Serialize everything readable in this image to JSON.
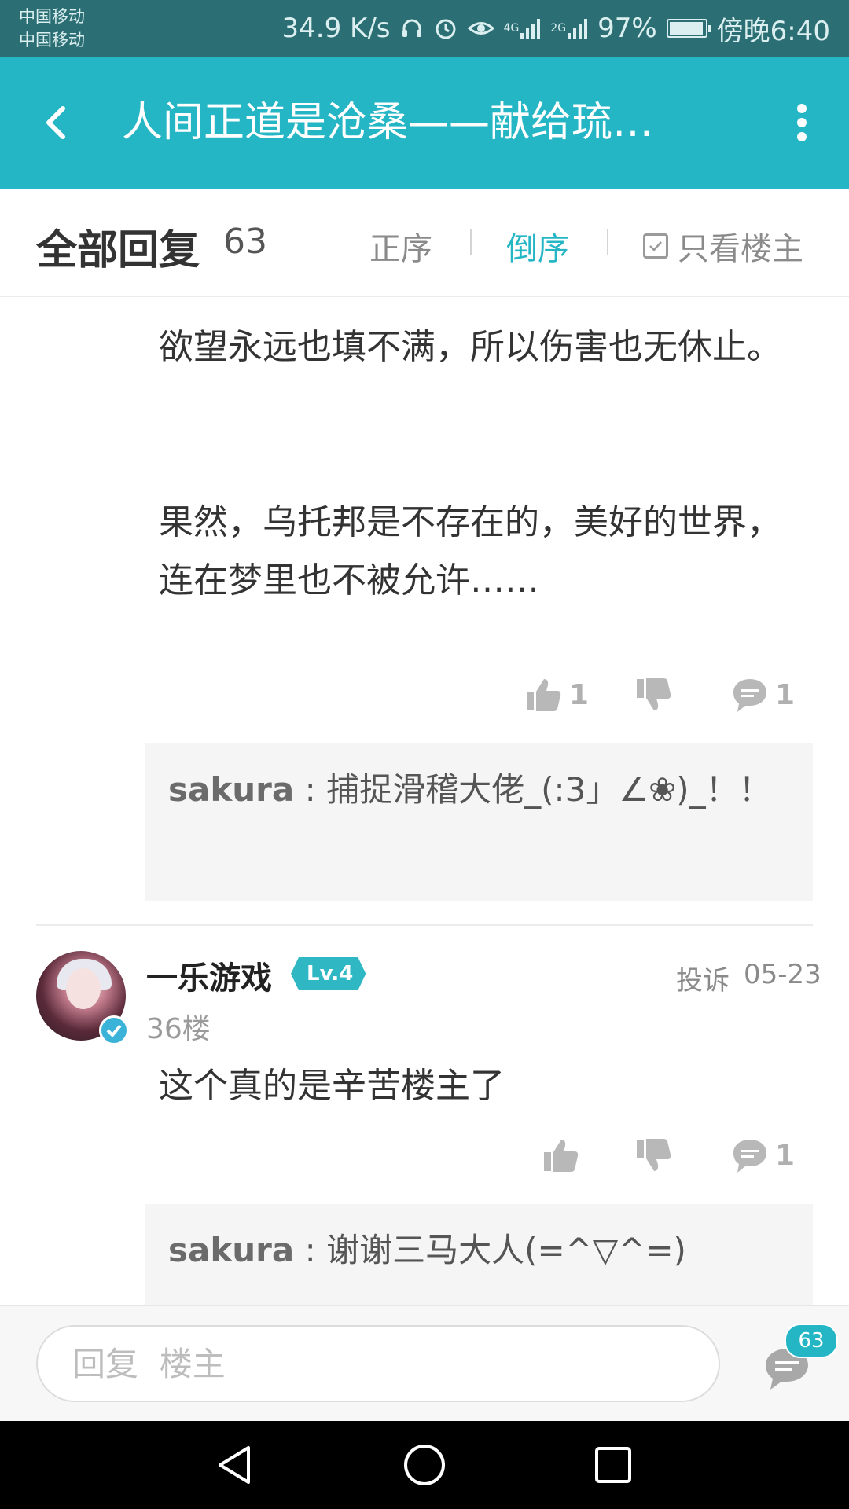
{
  "status_bar": {
    "carrier_1": "中国移动",
    "carrier_2": "中国移动",
    "network_speed": "34.9 K/s",
    "signal_1": "4G",
    "signal_2": "2G",
    "battery": "97%",
    "battery_level": 0.97,
    "time": "傍晚6:40"
  },
  "app_bar": {
    "title": "人间正道是沧桑——献给琉…"
  },
  "reply_header": {
    "title": "全部回复",
    "count": "63",
    "sort_asc": "正序",
    "sort_desc": "倒序",
    "sort_active": "倒序",
    "only_op": "只看楼主"
  },
  "comments": [
    {
      "paragraphs": [
        "欲望永远也填不满，所以伤害也无休止。",
        "果然，乌托邦是不存在的，美好的世界，连在梦里也不被允许……"
      ],
      "likes": "1",
      "replies": "1",
      "sub_reply": {
        "user": "sakura",
        "text": "捕捉滑稽大佬_(:3」∠❀)_！！"
      }
    },
    {
      "user": "一乐游戏",
      "level": "Lv.4",
      "report": "投诉",
      "date": "05-23",
      "floor": "36楼",
      "text": "这个真的是辛苦楼主了",
      "replies": "1",
      "sub_reply": {
        "user": "sakura",
        "text": "谢谢三马大人(=^▽^=)"
      }
    }
  ],
  "input_bar": {
    "placeholder": "回复  楼主",
    "reply_count": "63"
  },
  "colors": {
    "accent": "#24b6c5",
    "status_bar": "#2b6f74"
  }
}
